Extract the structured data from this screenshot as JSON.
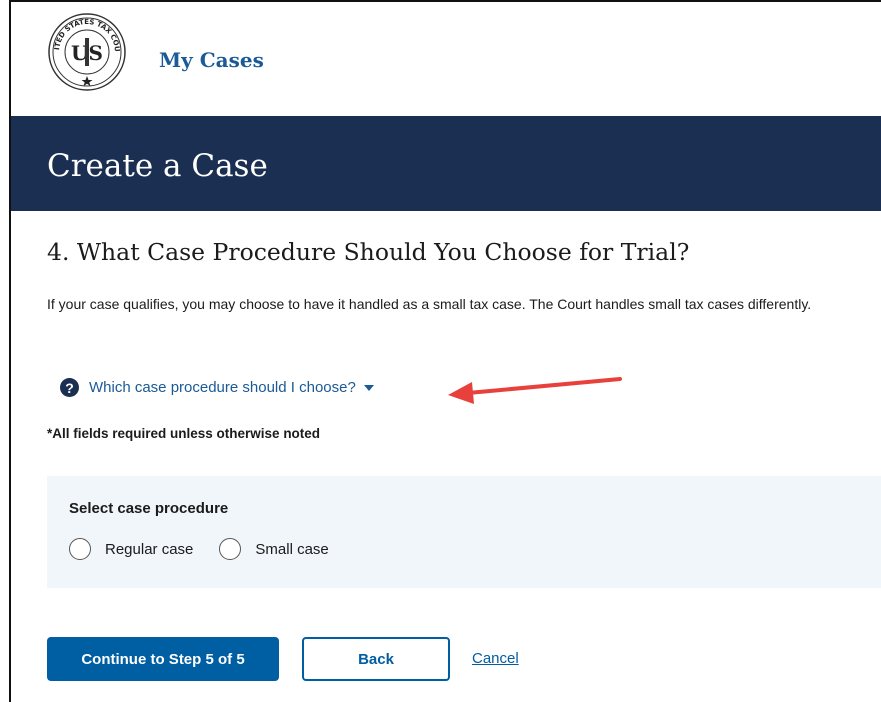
{
  "header": {
    "app_title": "My Cases",
    "seal": {
      "ring_text": "UNITED STATES TAX COURT",
      "monogram": "US"
    }
  },
  "banner": {
    "title": "Create a Case"
  },
  "main": {
    "section_title": "4. What Case Procedure Should You Choose for Trial?",
    "intro": "If your case qualifies, you may choose to have it handled as a small tax case. The Court handles small tax cases differently.",
    "help_toggle_label": "Which case procedure should I choose?",
    "required_note": "*All fields required unless otherwise noted",
    "procedure": {
      "legend": "Select case procedure",
      "options": [
        {
          "label": "Regular case",
          "selected": false
        },
        {
          "label": "Small case",
          "selected": false
        }
      ]
    },
    "actions": {
      "continue_label": "Continue to Step 5 of 5",
      "back_label": "Back",
      "cancel_label": "Cancel"
    }
  },
  "colors": {
    "banner_bg": "#1b2f52",
    "link": "#005ea2",
    "box_bg": "#f0f6f9",
    "annotation_arrow": "#e8403a"
  },
  "icons": [
    "court-seal-icon",
    "question-circle-icon",
    "caret-down-icon",
    "annotation-arrow-icon"
  ]
}
